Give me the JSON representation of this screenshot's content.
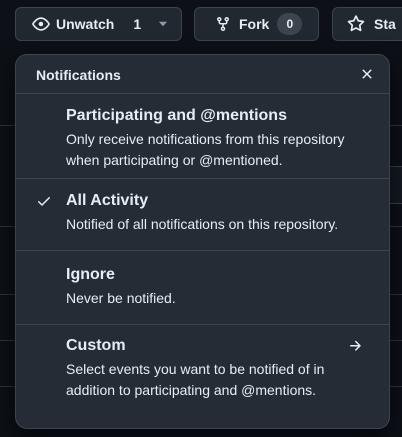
{
  "toolbar": {
    "watch_label": "Unwatch",
    "watch_count": "1",
    "fork_label": "Fork",
    "fork_count": "0",
    "star_label": "Sta"
  },
  "menu": {
    "title": "Notifications",
    "options": [
      {
        "title": "Participating and @mentions",
        "description": "Only receive notifications from this repository when participating or @mentioned.",
        "selected": false
      },
      {
        "title": "All Activity",
        "description": "Notified of all notifications on this repository.",
        "selected": true
      },
      {
        "title": "Ignore",
        "description": "Never be notified.",
        "selected": false
      },
      {
        "title": "Custom",
        "description": "Select events you want to be notified of in addition to participating and @mentions.",
        "selected": false
      }
    ]
  },
  "colors": {
    "page_background": "#0d1117",
    "menu_background": "#262c36",
    "border": "#3d444d",
    "text": "#e6edf3"
  },
  "icons": {
    "watch": "eye-icon",
    "watch_dropdown": "triangle-down-icon",
    "fork": "repo-forked-icon",
    "star": "star-icon",
    "close": "x-icon",
    "selected": "check-icon",
    "custom": "arrow-right-icon"
  }
}
